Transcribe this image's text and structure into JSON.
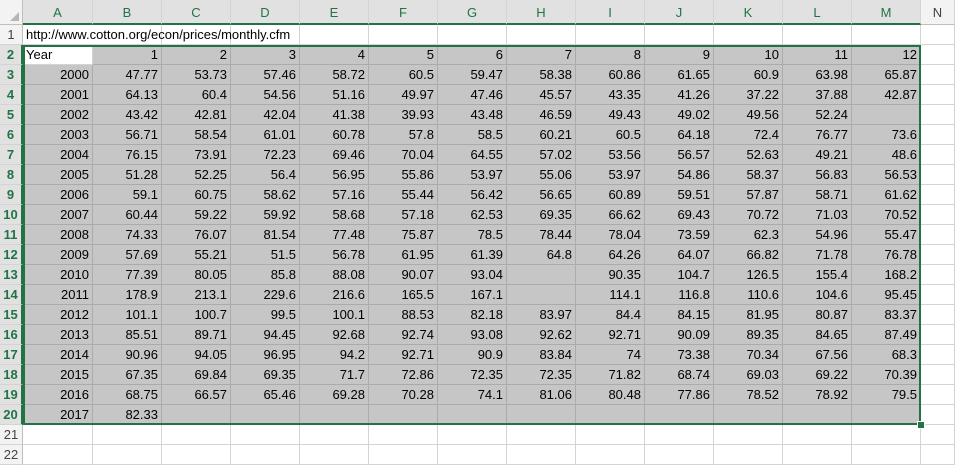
{
  "columns": [
    "A",
    "B",
    "C",
    "D",
    "E",
    "F",
    "G",
    "H",
    "I",
    "J",
    "K",
    "L",
    "M",
    "N"
  ],
  "row_numbers": [
    "1",
    "2",
    "3",
    "4",
    "5",
    "6",
    "7",
    "8",
    "9",
    "10",
    "11",
    "12",
    "13",
    "14",
    "15",
    "16",
    "17",
    "18",
    "19",
    "20",
    "21",
    "22"
  ],
  "url_cell": "http://www.cotton.org/econ/prices/monthly.cfm",
  "header_row": [
    "Year",
    "1",
    "2",
    "3",
    "4",
    "5",
    "6",
    "7",
    "8",
    "9",
    "10",
    "11",
    "12"
  ],
  "data_rows": [
    [
      "2000",
      "47.77",
      "53.73",
      "57.46",
      "58.72",
      "60.5",
      "59.47",
      "58.38",
      "60.86",
      "61.65",
      "60.9",
      "63.98",
      "65.87"
    ],
    [
      "2001",
      "64.13",
      "60.4",
      "54.56",
      "51.16",
      "49.97",
      "47.46",
      "45.57",
      "43.35",
      "41.26",
      "37.22",
      "37.88",
      "42.87"
    ],
    [
      "2002",
      "43.42",
      "42.81",
      "42.04",
      "41.38",
      "39.93",
      "43.48",
      "46.59",
      "49.43",
      "49.02",
      "49.56",
      "52.24",
      ""
    ],
    [
      "2003",
      "56.71",
      "58.54",
      "61.01",
      "60.78",
      "57.8",
      "58.5",
      "60.21",
      "60.5",
      "64.18",
      "72.4",
      "76.77",
      "73.6"
    ],
    [
      "2004",
      "76.15",
      "73.91",
      "72.23",
      "69.46",
      "70.04",
      "64.55",
      "57.02",
      "53.56",
      "56.57",
      "52.63",
      "49.21",
      "48.6"
    ],
    [
      "2005",
      "51.28",
      "52.25",
      "56.4",
      "56.95",
      "55.86",
      "53.97",
      "55.06",
      "53.97",
      "54.86",
      "58.37",
      "56.83",
      "56.53"
    ],
    [
      "2006",
      "59.1",
      "60.75",
      "58.62",
      "57.16",
      "55.44",
      "56.42",
      "56.65",
      "60.89",
      "59.51",
      "57.87",
      "58.71",
      "61.62"
    ],
    [
      "2007",
      "60.44",
      "59.22",
      "59.92",
      "58.68",
      "57.18",
      "62.53",
      "69.35",
      "66.62",
      "69.43",
      "70.72",
      "71.03",
      "70.52"
    ],
    [
      "2008",
      "74.33",
      "76.07",
      "81.54",
      "77.48",
      "75.87",
      "78.5",
      "78.44",
      "78.04",
      "73.59",
      "62.3",
      "54.96",
      "55.47"
    ],
    [
      "2009",
      "57.69",
      "55.21",
      "51.5",
      "56.78",
      "61.95",
      "61.39",
      "64.8",
      "64.26",
      "64.07",
      "66.82",
      "71.78",
      "76.78"
    ],
    [
      "2010",
      "77.39",
      "80.05",
      "85.8",
      "88.08",
      "90.07",
      "93.04",
      "",
      "90.35",
      "104.7",
      "126.5",
      "155.4",
      "168.2"
    ],
    [
      "2011",
      "178.9",
      "213.1",
      "229.6",
      "216.6",
      "165.5",
      "167.1",
      "",
      "114.1",
      "116.8",
      "110.6",
      "104.6",
      "95.45"
    ],
    [
      "2012",
      "101.1",
      "100.7",
      "99.5",
      "100.1",
      "88.53",
      "82.18",
      "83.97",
      "84.4",
      "84.15",
      "81.95",
      "80.87",
      "83.37"
    ],
    [
      "2013",
      "85.51",
      "89.71",
      "94.45",
      "92.68",
      "92.74",
      "93.08",
      "92.62",
      "92.71",
      "90.09",
      "89.35",
      "84.65",
      "87.49"
    ],
    [
      "2014",
      "90.96",
      "94.05",
      "96.95",
      "94.2",
      "92.71",
      "90.9",
      "83.84",
      "74",
      "73.38",
      "70.34",
      "67.56",
      "68.3"
    ],
    [
      "2015",
      "67.35",
      "69.84",
      "69.35",
      "71.7",
      "72.86",
      "72.35",
      "72.35",
      "71.82",
      "68.74",
      "69.03",
      "69.22",
      "70.39"
    ],
    [
      "2016",
      "68.75",
      "66.57",
      "65.46",
      "69.28",
      "70.28",
      "74.1",
      "81.06",
      "80.48",
      "77.86",
      "78.52",
      "78.92",
      "79.5"
    ],
    [
      "2017",
      "82.33",
      "",
      "",
      "",
      "",
      "",
      "",
      "",
      "",
      "",
      "",
      ""
    ]
  ],
  "colors": {
    "selection_border": "#217346",
    "selection_fill": "#c6c6c6",
    "header_bg": "#f3f3f3",
    "gridline": "#d4d4d4"
  },
  "icons": {
    "select_all": "select-all-triangle-icon",
    "fill_handle": "fill-handle-icon"
  }
}
